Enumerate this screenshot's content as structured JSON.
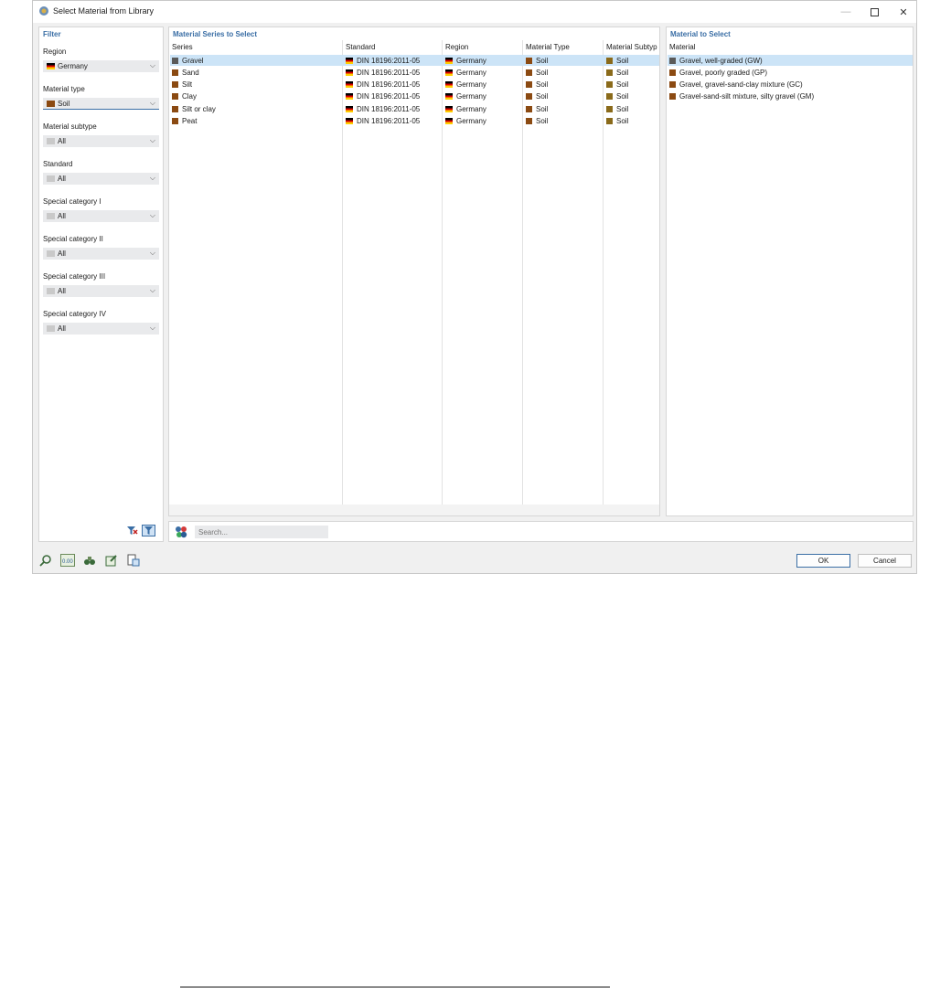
{
  "window": {
    "title": "Select Material from Library"
  },
  "filter": {
    "heading": "Filter",
    "fields": [
      {
        "label": "Region",
        "value": "Germany",
        "icon": "germany-flag-icon"
      },
      {
        "label": "Material type",
        "value": "Soil",
        "icon": "soil-swatch-icon"
      },
      {
        "label": "Material subtype",
        "value": "All",
        "icon": "gray-swatch-icon"
      },
      {
        "label": "Standard",
        "value": "All",
        "icon": "gray-swatch-icon"
      },
      {
        "label": "Special category I",
        "value": "All",
        "icon": "gray-swatch-icon"
      },
      {
        "label": "Special category II",
        "value": "All",
        "icon": "gray-swatch-icon"
      },
      {
        "label": "Special category III",
        "value": "All",
        "icon": "gray-swatch-icon"
      },
      {
        "label": "Special category IV",
        "value": "All",
        "icon": "gray-swatch-icon"
      }
    ]
  },
  "series_panel": {
    "heading": "Material Series to Select",
    "columns": [
      "Series",
      "Standard",
      "Region",
      "Material Type",
      "Material Subtyp"
    ],
    "rows": [
      {
        "series": "Gravel",
        "standard": "DIN 18196:2011-05",
        "region": "Germany",
        "type": "Soil",
        "subtype": "Soil",
        "series_color": "#5a5a5a"
      },
      {
        "series": "Sand",
        "standard": "DIN 18196:2011-05",
        "region": "Germany",
        "type": "Soil",
        "subtype": "Soil",
        "series_color": "#8b4a12"
      },
      {
        "series": "Silt",
        "standard": "DIN 18196:2011-05",
        "region": "Germany",
        "type": "Soil",
        "subtype": "Soil",
        "series_color": "#8b4a12"
      },
      {
        "series": "Clay",
        "standard": "DIN 18196:2011-05",
        "region": "Germany",
        "type": "Soil",
        "subtype": "Soil",
        "series_color": "#8b4a12"
      },
      {
        "series": "Silt or clay",
        "standard": "DIN 18196:2011-05",
        "region": "Germany",
        "type": "Soil",
        "subtype": "Soil",
        "series_color": "#8b4a12"
      },
      {
        "series": "Peat",
        "standard": "DIN 18196:2011-05",
        "region": "Germany",
        "type": "Soil",
        "subtype": "Soil",
        "series_color": "#8b4a12"
      }
    ]
  },
  "material_panel": {
    "heading": "Material to Select",
    "column": "Material",
    "rows": [
      {
        "name": "Gravel, well-graded (GW)",
        "color": "#5a5a5a"
      },
      {
        "name": "Gravel, poorly graded (GP)",
        "color": "#8b4a12"
      },
      {
        "name": "Gravel, gravel-sand-clay mixture (GC)",
        "color": "#8b4a12"
      },
      {
        "name": "Gravel-sand-silt mixture, silty gravel (GM)",
        "color": "#8b4a12"
      }
    ]
  },
  "search": {
    "placeholder": "Search..."
  },
  "buttons": {
    "ok": "OK",
    "cancel": "Cancel"
  },
  "colors": {
    "accent": "#3a6ea5",
    "selection": "#cce4f7",
    "soil": "#8b4a12"
  }
}
